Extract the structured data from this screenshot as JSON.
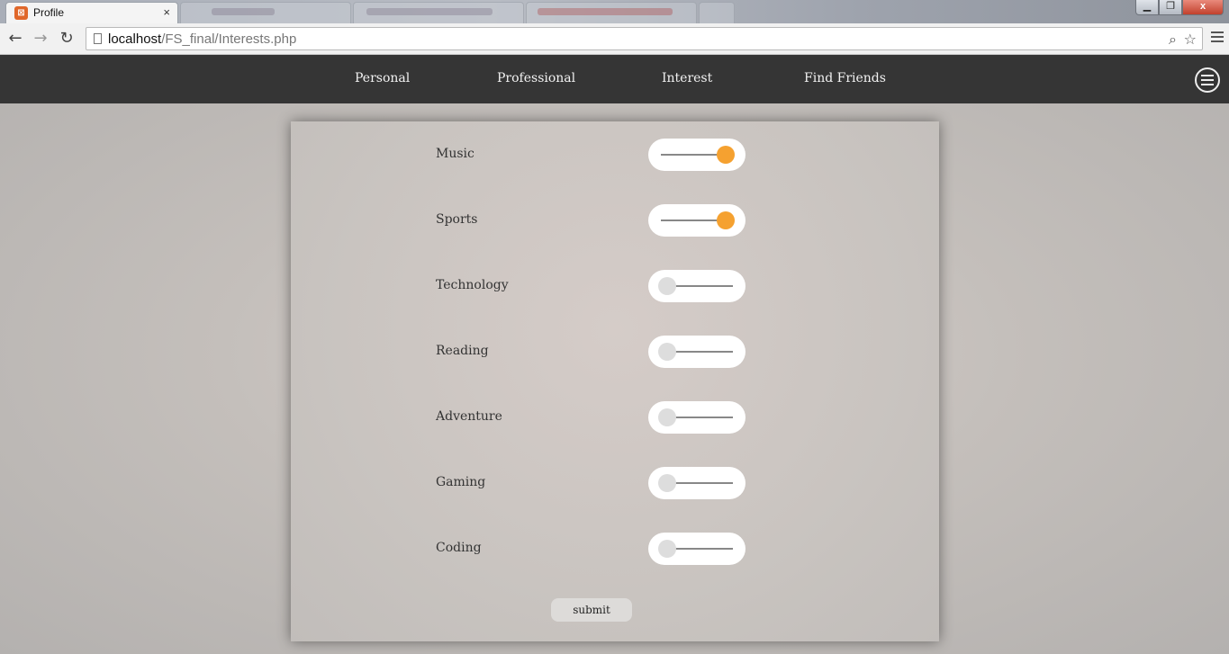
{
  "browser": {
    "tab_title": "Profile",
    "tab_close": "×",
    "url_host": "localhost",
    "url_path": "/FS_final/Interests.php",
    "window_controls": {
      "close_label": "x"
    }
  },
  "nav": {
    "links": [
      "Personal",
      "Professional",
      "Interest",
      "Find Friends"
    ]
  },
  "form": {
    "interests": [
      {
        "label": "Music",
        "on": true
      },
      {
        "label": "Sports",
        "on": true
      },
      {
        "label": "Technology",
        "on": false
      },
      {
        "label": "Reading",
        "on": false
      },
      {
        "label": "Adventure",
        "on": false
      },
      {
        "label": "Gaming",
        "on": false
      },
      {
        "label": "Coding",
        "on": false
      }
    ],
    "submit_label": "submit"
  },
  "colors": {
    "toggle_on": "#f5a130",
    "toggle_off": "#dddddd",
    "nav_bg": "#353535"
  }
}
